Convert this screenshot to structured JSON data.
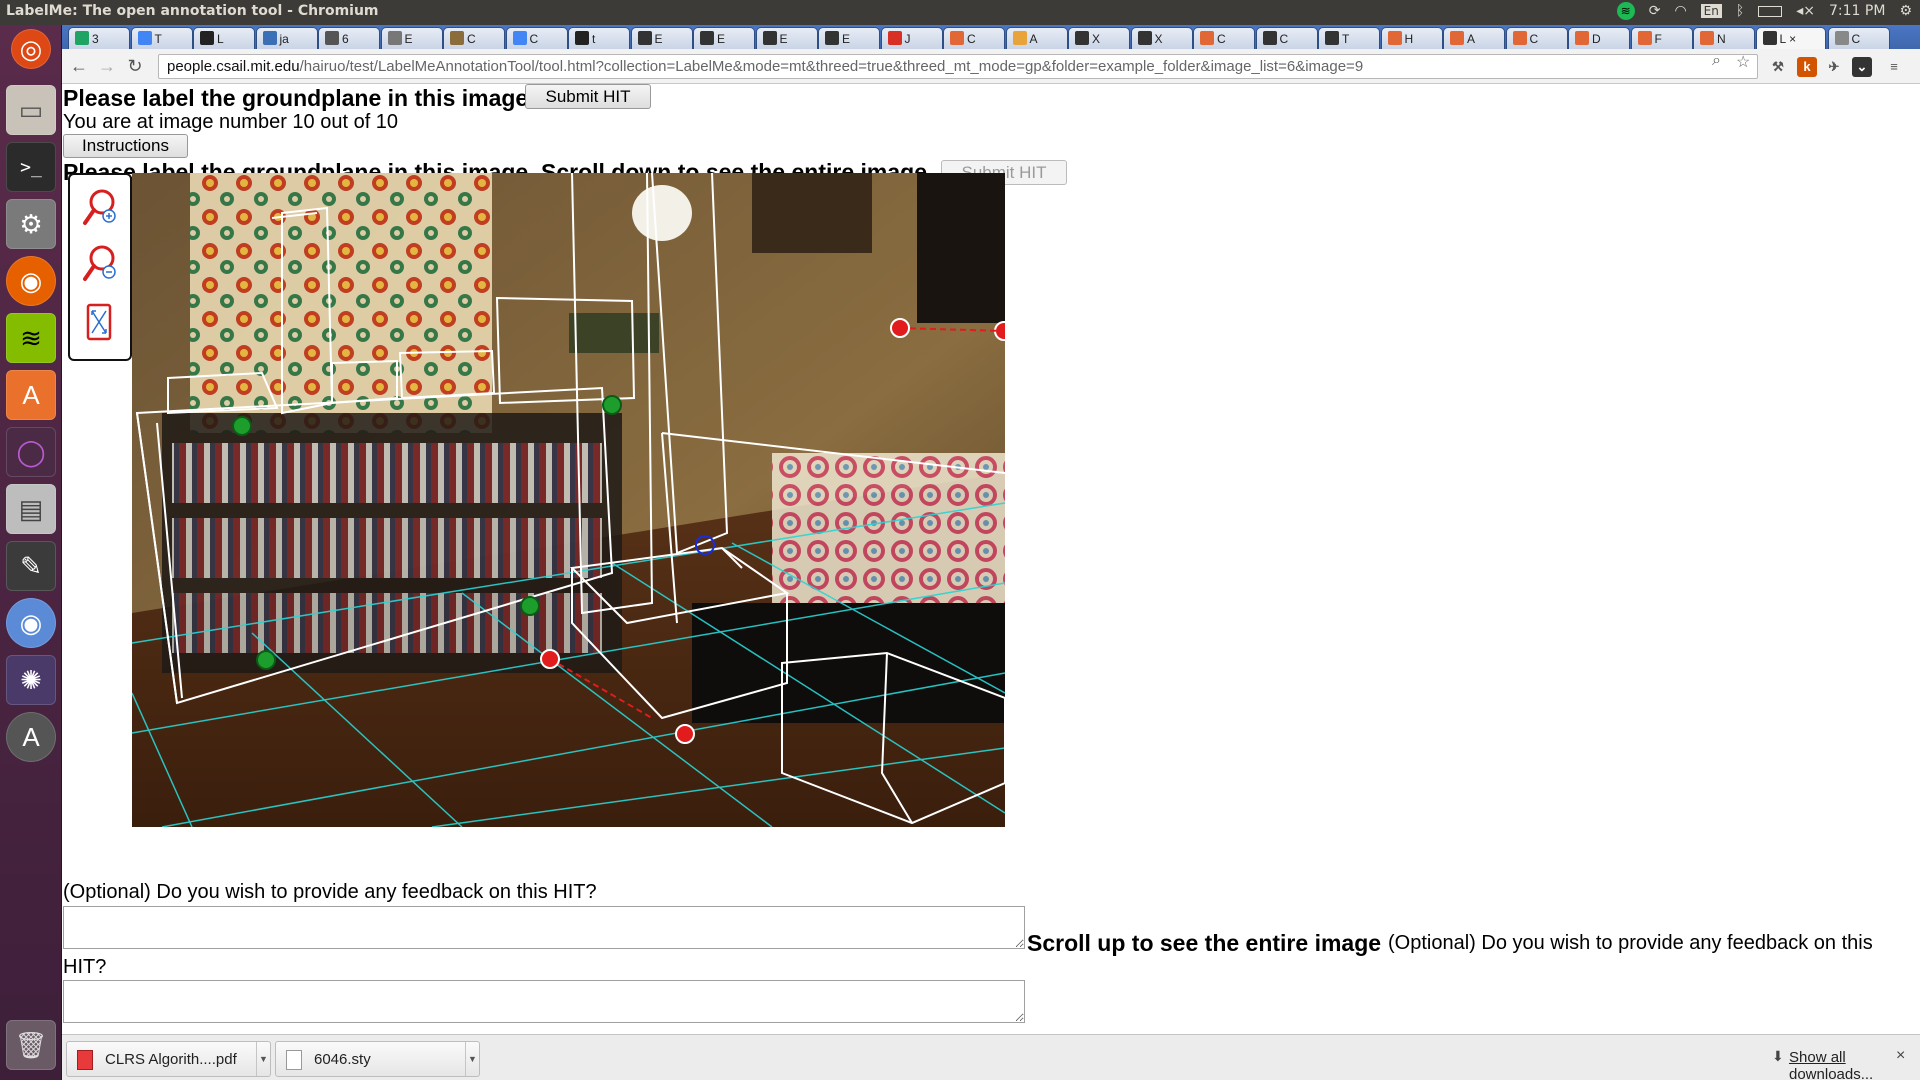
{
  "window": {
    "title": "LabelMe: The open annotation tool - Chromium",
    "clock": "7:11 PM",
    "keyboard_layout": "En"
  },
  "tabs": [
    {
      "label": "3",
      "icon": "drive-icon",
      "color": "#1fa463"
    },
    {
      "label": "T",
      "icon": "docs-icon",
      "color": "#4285f4"
    },
    {
      "label": "L",
      "icon": "github-icon",
      "color": "#222222"
    },
    {
      "label": "ja",
      "icon": "shield-icon",
      "color": "#3b6fb6"
    },
    {
      "label": "6",
      "icon": "bookmark-icon",
      "color": "#555555"
    },
    {
      "label": "E",
      "icon": "page-icon",
      "color": "#777777"
    },
    {
      "label": "C",
      "icon": "scholar-icon",
      "color": "#8a6d3b"
    },
    {
      "label": "C",
      "icon": "docs-icon",
      "color": "#4285f4"
    },
    {
      "label": "t",
      "icon": "github-icon",
      "color": "#222222"
    },
    {
      "label": "E",
      "icon": "wolfram-icon",
      "color": "#333333"
    },
    {
      "label": "E",
      "icon": "wolfram-icon",
      "color": "#333333"
    },
    {
      "label": "E",
      "icon": "wolfram-icon",
      "color": "#333333"
    },
    {
      "label": "E",
      "icon": "wolfram-icon",
      "color": "#333333"
    },
    {
      "label": "J",
      "icon": "gmail-icon",
      "color": "#d93025"
    },
    {
      "label": "C",
      "icon": "matlab-icon",
      "color": "#e16737"
    },
    {
      "label": "A",
      "icon": "scholar-icon",
      "color": "#e8a33b"
    },
    {
      "label": "X",
      "icon": "w3-icon",
      "color": "#333333"
    },
    {
      "label": "X",
      "icon": "w3-icon",
      "color": "#333333"
    },
    {
      "label": "C",
      "icon": "matlab-icon",
      "color": "#e16737"
    },
    {
      "label": "C",
      "icon": "wikipedia-icon",
      "color": "#333333"
    },
    {
      "label": "T",
      "icon": "wikipedia-icon",
      "color": "#333333"
    },
    {
      "label": "H",
      "icon": "matlab-icon",
      "color": "#e16737"
    },
    {
      "label": "A",
      "icon": "matlab-icon",
      "color": "#e16737"
    },
    {
      "label": "C",
      "icon": "matlab-icon",
      "color": "#e16737"
    },
    {
      "label": "D",
      "icon": "matlab-icon",
      "color": "#e16737"
    },
    {
      "label": "F",
      "icon": "matlab-icon",
      "color": "#e16737"
    },
    {
      "label": "N",
      "icon": "matlab-icon",
      "color": "#e16737"
    },
    {
      "label": "L",
      "icon": "labelme-icon",
      "color": "#333333",
      "active": true
    },
    {
      "label": "C",
      "icon": "page-icon",
      "color": "#888888"
    }
  ],
  "toolbar": {
    "url_host": "people.csail.mit.edu",
    "url_rest": "/hairuo/test/LabelMeAnnotationTool/tool.html?collection=LabelMe&mode=mt&threed=true&threed_mt_mode=gp&folder=example_folder&image_list=6&image=9"
  },
  "page": {
    "heading": "Please label the groundplane in this image.",
    "submit_label": "Submit HIT",
    "progress_text": "You are at image number 10 out of 10",
    "instructions_label": "Instructions",
    "heading_scroll": "Please label the groundplane in this image. Scroll down to see the entire image.",
    "submit_label_2": "Submit HIT",
    "feedback_question": "(Optional) Do you wish to provide any feedback on this HIT?",
    "scroll_up_text": "Scroll up to see the entire image",
    "feedback_question_2a": "(Optional) Do you wish to provide any feedback on this",
    "feedback_question_2b": "HIT?"
  },
  "tools": [
    "zoom-in-icon",
    "zoom-out-icon",
    "fit-image-icon"
  ],
  "downloads": {
    "items": [
      {
        "name": "CLRS Algorith....pdf",
        "icon": "pdf-icon"
      },
      {
        "name": "6046.sty",
        "icon": "file-icon"
      }
    ],
    "show_all": "Show all downloads...",
    "close": "×"
  }
}
